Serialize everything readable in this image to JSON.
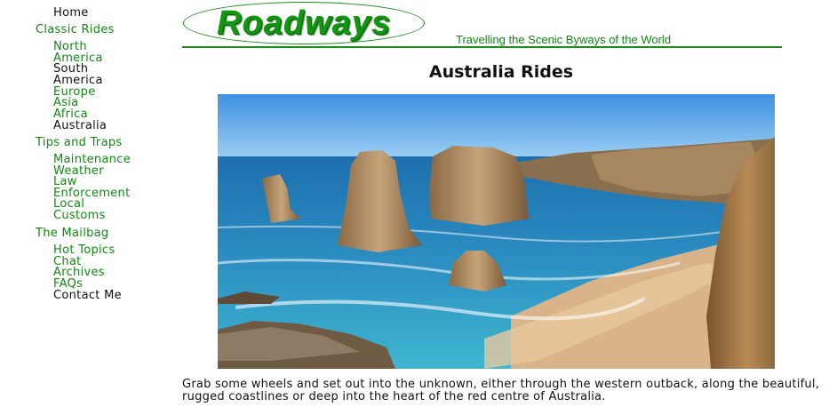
{
  "nav": {
    "home": "Home",
    "classic_rides": "Classic Rides",
    "north_america_1": "North",
    "north_america_2": "America",
    "south_america_1": "South",
    "south_america_2": "America",
    "europe": "Europe",
    "asia": "Asia",
    "africa": "Africa",
    "australia": "Australia",
    "tips_and_traps": "Tips and Traps",
    "maintenance": "Maintenance",
    "weather": "Weather",
    "law_1": "Law",
    "law_2": "Enforcement",
    "local_1": "Local",
    "local_2": "Customs",
    "mailbag": "The Mailbag",
    "hot_topics": "Hot Topics",
    "chat": "Chat",
    "archives": "Archives",
    "faqs": "FAQs",
    "contact": "Contact Me"
  },
  "header": {
    "logo": "Roadways",
    "tagline": "Travelling the Scenic Byways of the World"
  },
  "main": {
    "title": "Australia Rides",
    "intro": "Grab some wheels and set out into the unknown, either through the western outback, along the beautiful, rugged coastlines or deep into the heart of the red centre of Australia."
  },
  "colors": {
    "link_green": "#118811",
    "text": "#111111",
    "rule": "#1d8a1d"
  }
}
